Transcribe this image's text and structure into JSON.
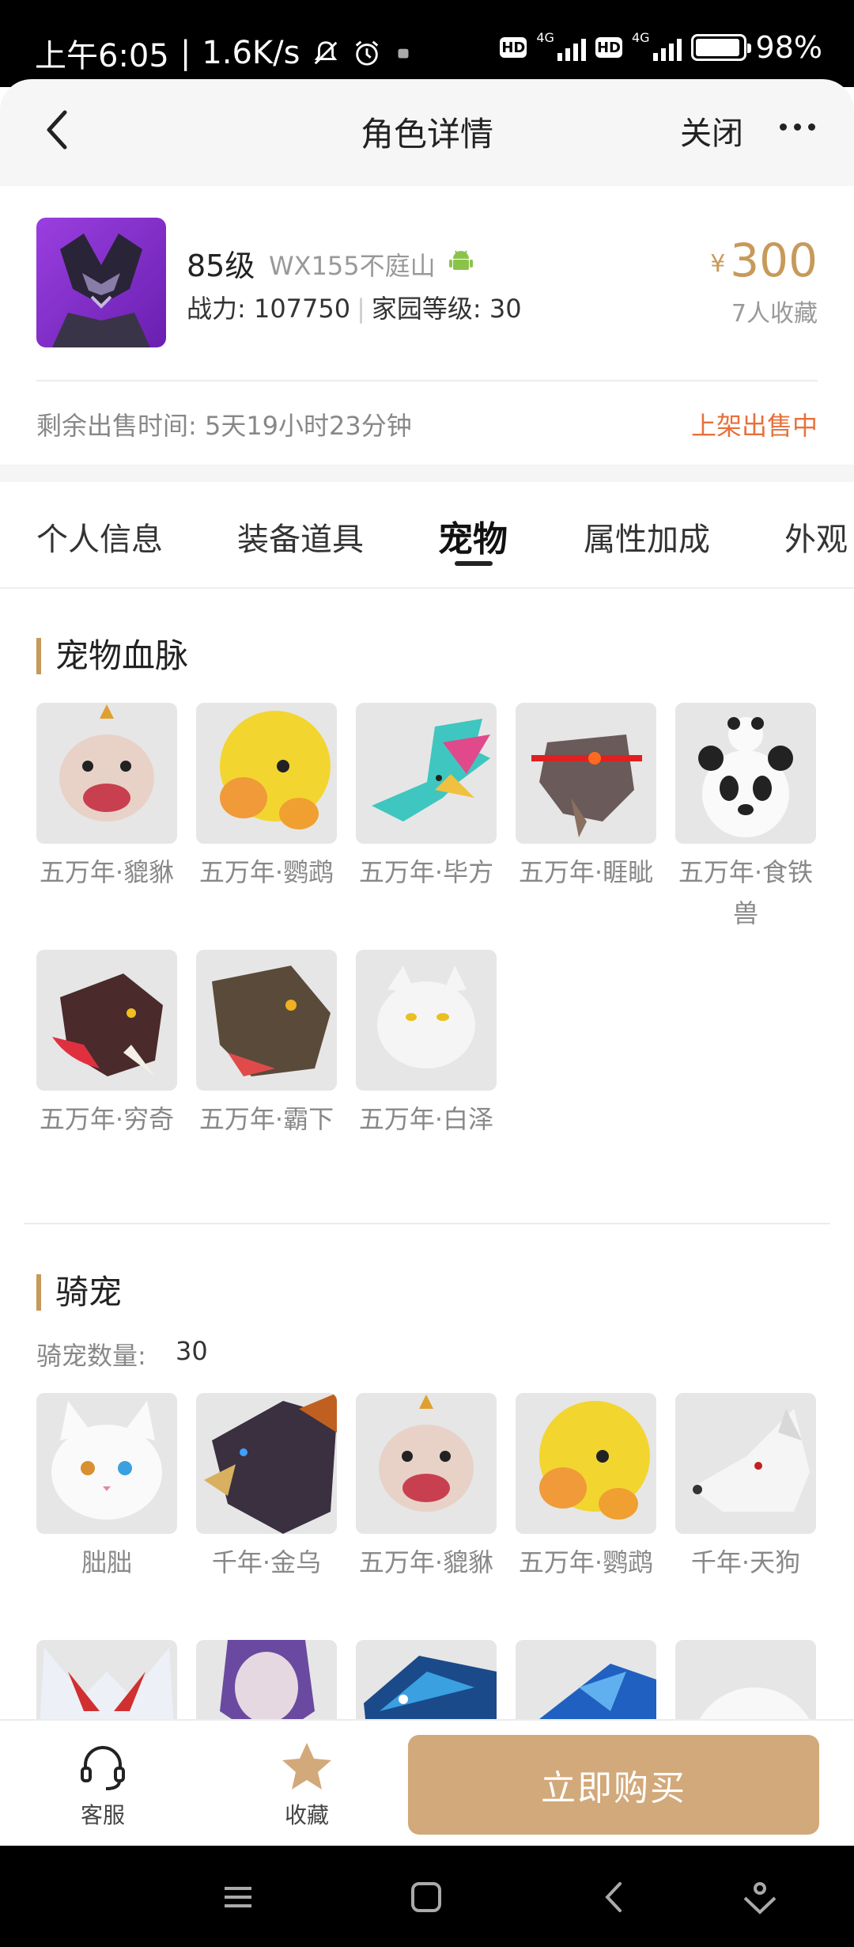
{
  "status_bar": {
    "time": "上午6:05",
    "speed": "1.6K/s",
    "network_1": "4G",
    "network_2": "4G",
    "hd": "HD",
    "battery": "98%"
  },
  "header": {
    "title": "角色详情",
    "close_label": "关闭"
  },
  "character": {
    "level": "85级",
    "server": "WX155不庭山",
    "stats_power": "战力: 107750",
    "stats_home": "家园等级: 30",
    "price_currency": "¥",
    "price": "300",
    "favorites": "7人收藏",
    "remaining_time": "剩余出售时间: 5天19小时23分钟",
    "sale_status": "上架出售中"
  },
  "tabs": [
    {
      "label": "个人信息",
      "active": false
    },
    {
      "label": "装备道具",
      "active": false
    },
    {
      "label": "宠物",
      "active": true
    },
    {
      "label": "属性加成",
      "active": false
    },
    {
      "label": "外观",
      "active": false
    }
  ],
  "pet_bloodline": {
    "title": "宠物血脉",
    "items": [
      {
        "name": "五万年·貔貅",
        "icon": "pixiu-icon"
      },
      {
        "name": "五万年·鹦鹉",
        "icon": "parrot-icon"
      },
      {
        "name": "五万年·毕方",
        "icon": "bifang-icon"
      },
      {
        "name": "五万年·睚眦",
        "icon": "yazi-icon"
      },
      {
        "name": "五万年·食铁兽",
        "icon": "panda-icon"
      },
      {
        "name": "五万年·穷奇",
        "icon": "qiongqi-icon"
      },
      {
        "name": "五万年·霸下",
        "icon": "baxia-icon"
      },
      {
        "name": "五万年·白泽",
        "icon": "baize-icon"
      }
    ]
  },
  "mounts": {
    "title": "骑宠",
    "count_label": "骑宠数量:",
    "count_value": "30",
    "items": [
      {
        "name": "胐胐",
        "icon": "white-cat-icon"
      },
      {
        "name": "千年·金乌",
        "icon": "dragon-icon"
      },
      {
        "name": "五万年·貔貅",
        "icon": "pixiu-icon"
      },
      {
        "name": "五万年·鹦鹉",
        "icon": "parrot-icon"
      },
      {
        "name": "千年·天狗",
        "icon": "white-wolf-icon"
      }
    ]
  },
  "bottom_bar": {
    "service_label": "客服",
    "favorite_label": "收藏",
    "buy_label": "立即购买"
  },
  "colors": {
    "accent_gold": "#c79a5a",
    "buy_button": "#d2a97a",
    "sale_orange": "#e8703a"
  }
}
